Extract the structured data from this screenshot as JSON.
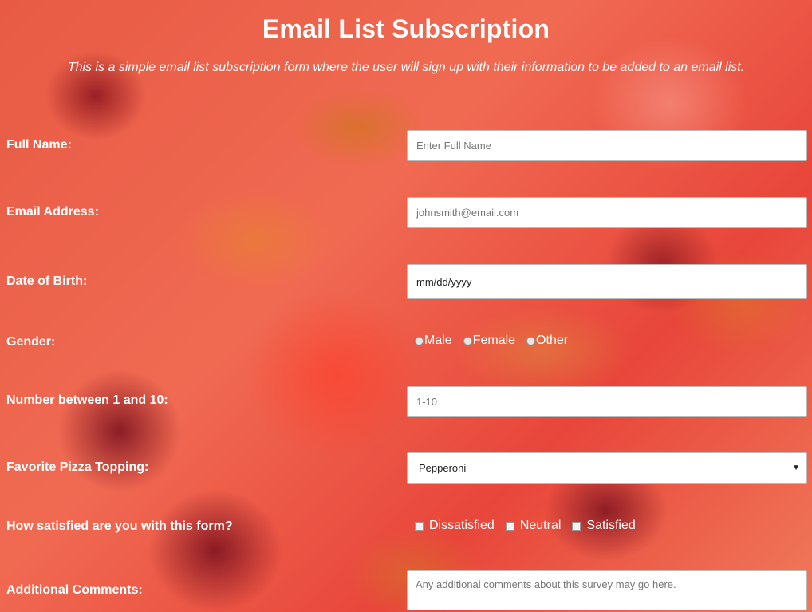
{
  "header": {
    "title": "Email List Subscription",
    "subtitle": "This is a simple email list subscription form where the user will sign up with their information to be added to an email list."
  },
  "form": {
    "full_name": {
      "label": "Full Name:",
      "placeholder": "Enter Full Name"
    },
    "email": {
      "label": "Email Address:",
      "placeholder": "johnsmith@email.com"
    },
    "dob": {
      "label": "Date of Birth:",
      "value": "mm/dd/yyyy"
    },
    "gender": {
      "label": "Gender:",
      "options": [
        "Male",
        "Female",
        "Other"
      ]
    },
    "number": {
      "label": "Number between 1 and 10:",
      "placeholder": "1-10"
    },
    "topping": {
      "label": "Favorite Pizza Topping:",
      "selected": "Pepperoni",
      "icon": "chevron-down-icon"
    },
    "satisfaction": {
      "label": "How satisfied are you with this form?",
      "options": [
        "Dissatisfied",
        "Neutral",
        "Satisfied"
      ]
    },
    "comments": {
      "label": "Additional Comments:",
      "placeholder": "Any additional comments about this survey may go here."
    }
  },
  "colors": {
    "text": "#ffffff",
    "background_tint": "#e8463a"
  }
}
